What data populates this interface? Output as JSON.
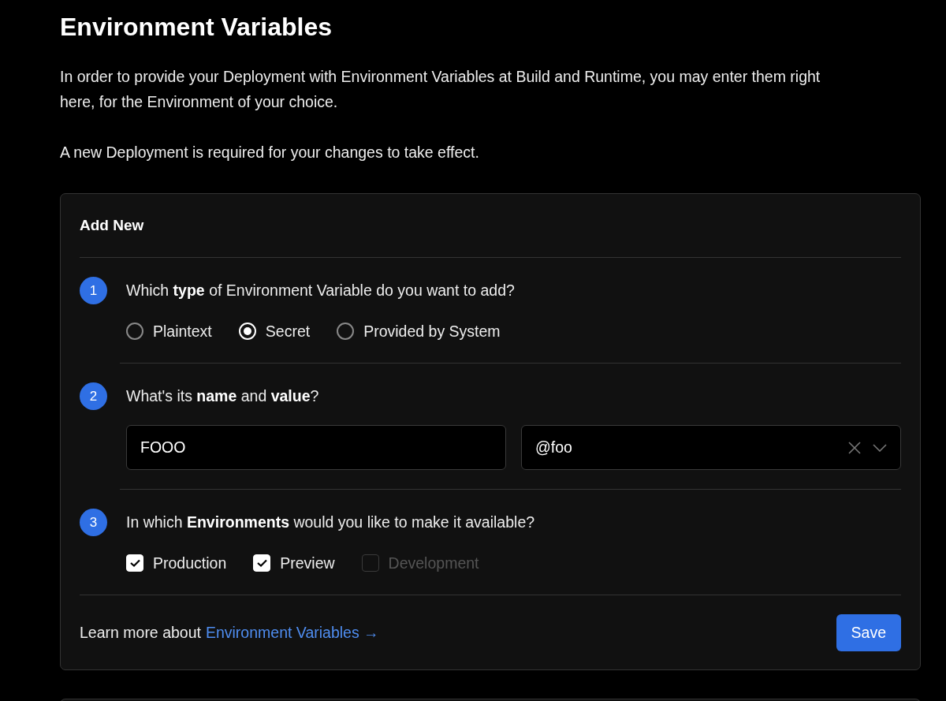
{
  "title": "Environment Variables",
  "intro": [
    "In order to provide your Deployment with Environment Variables at Build and Runtime, you may enter them right here, for the Environment of your choice.",
    "A new Deployment is required for your changes to take effect."
  ],
  "card": {
    "title": "Add New",
    "steps": [
      {
        "number": "1",
        "kind": "radios",
        "question": "Which **type** of Environment Variable do you want to add?",
        "options": [
          {
            "label": "Plaintext",
            "selected": false
          },
          {
            "label": "Secret",
            "selected": true
          },
          {
            "label": "Provided by System",
            "selected": false
          }
        ]
      },
      {
        "number": "2",
        "kind": "fields",
        "question": "What's its **name** and **value**?",
        "name_value": "FOOO",
        "value_value": "@foo"
      },
      {
        "number": "3",
        "kind": "checkboxes",
        "question": "In which **Environments** would you like to make it available?",
        "options": [
          {
            "label": "Production",
            "checked": true,
            "disabled": false
          },
          {
            "label": "Preview",
            "checked": true,
            "disabled": false
          },
          {
            "label": "Development",
            "checked": false,
            "disabled": true
          }
        ]
      }
    ],
    "footer": {
      "text": "Learn more about",
      "link": "Environment Variables →"
    },
    "button": "Save"
  }
}
